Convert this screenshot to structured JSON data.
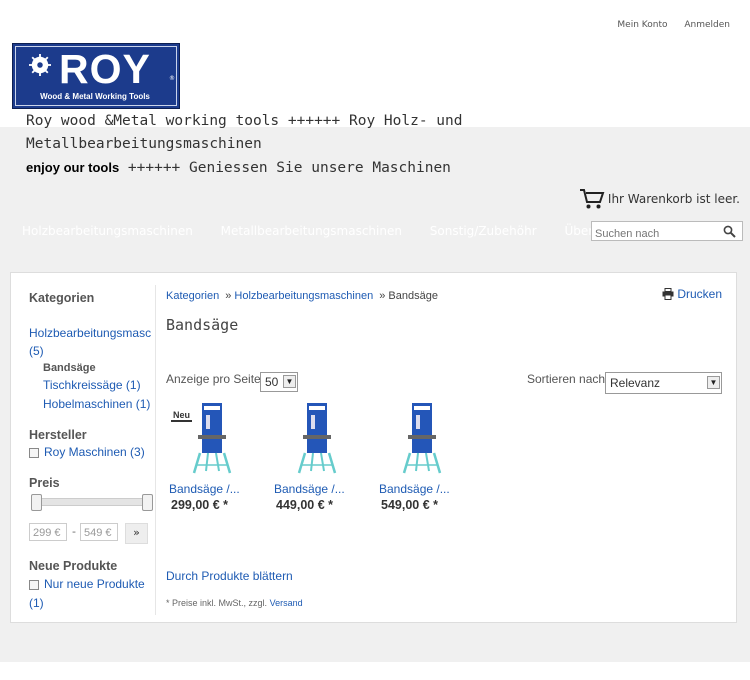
{
  "account": {
    "my_account": "Mein Konto",
    "login": "Anmelden"
  },
  "brand": {
    "logo_text": "ROY",
    "reg_mark": "®",
    "logo_tagline": "Wood & Metal Working Tools",
    "colors": {
      "logo_bg": "#1c3b8c",
      "link": "#1e5bb3"
    }
  },
  "headline": {
    "line1": "Roy wood &Metal working tools ++++++ Roy Holz- und",
    "line2": "Metallbearbeitungsmaschinen"
  },
  "subline": {
    "bold": "enjoy our tools",
    "rest": "++++++ Geniessen Sie unsere Maschinen"
  },
  "cart": {
    "icon": "cart-icon",
    "text": "Ihr Warenkorb ist leer."
  },
  "nav": {
    "items": [
      "Holzbearbeitungsmaschinen",
      "Metallbearbeitungsmaschinen",
      "Sonstig/Zubehöhr",
      "Über uns"
    ]
  },
  "search": {
    "placeholder": "Suchen nach",
    "icon": "magnifier-icon"
  },
  "sidebar": {
    "categories_title": "Kategorien",
    "category_link": "Holzbearbeitungsmaschi",
    "category_count": "(5)",
    "current": "Bandsäge",
    "subcats": [
      {
        "label": "Tischkreissäge (1)"
      },
      {
        "label": "Hobelmaschinen (1)"
      }
    ],
    "manufacturer_title": "Hersteller",
    "manufacturer": "Roy Maschinen (3)",
    "price_title": "Preis",
    "price_min": "299 €",
    "price_max": "549 €",
    "price_sep": "-",
    "price_go": "»",
    "new_title": "Neue Produkte",
    "new_only": "Nur neue Produkte",
    "new_count": "(1)"
  },
  "breadcrumb": {
    "root": "Kategorien",
    "sep": "»",
    "cat": "Holzbearbeitungsmaschinen",
    "current": "Bandsäge"
  },
  "print": {
    "label": "Drucken",
    "icon": "printer-icon"
  },
  "page_title": "Bandsäge",
  "listing": {
    "per_page_label": "Anzeige pro Seite",
    "per_page_value": "50",
    "sort_label": "Sortieren nach",
    "sort_value": "Relevanz",
    "arrow": "▼",
    "products": [
      {
        "name": "Bandsäge /...",
        "price": "299,00 € *",
        "badge": "Neu"
      },
      {
        "name": "Bandsäge /...",
        "price": "449,00 € *"
      },
      {
        "name": "Bandsäge /...",
        "price": "549,00 € *"
      }
    ],
    "browse": "Durch Produkte blättern",
    "footnote_star": "*",
    "footnote": "Preise inkl. MwSt., zzgl.",
    "footnote_link": "Versand"
  }
}
